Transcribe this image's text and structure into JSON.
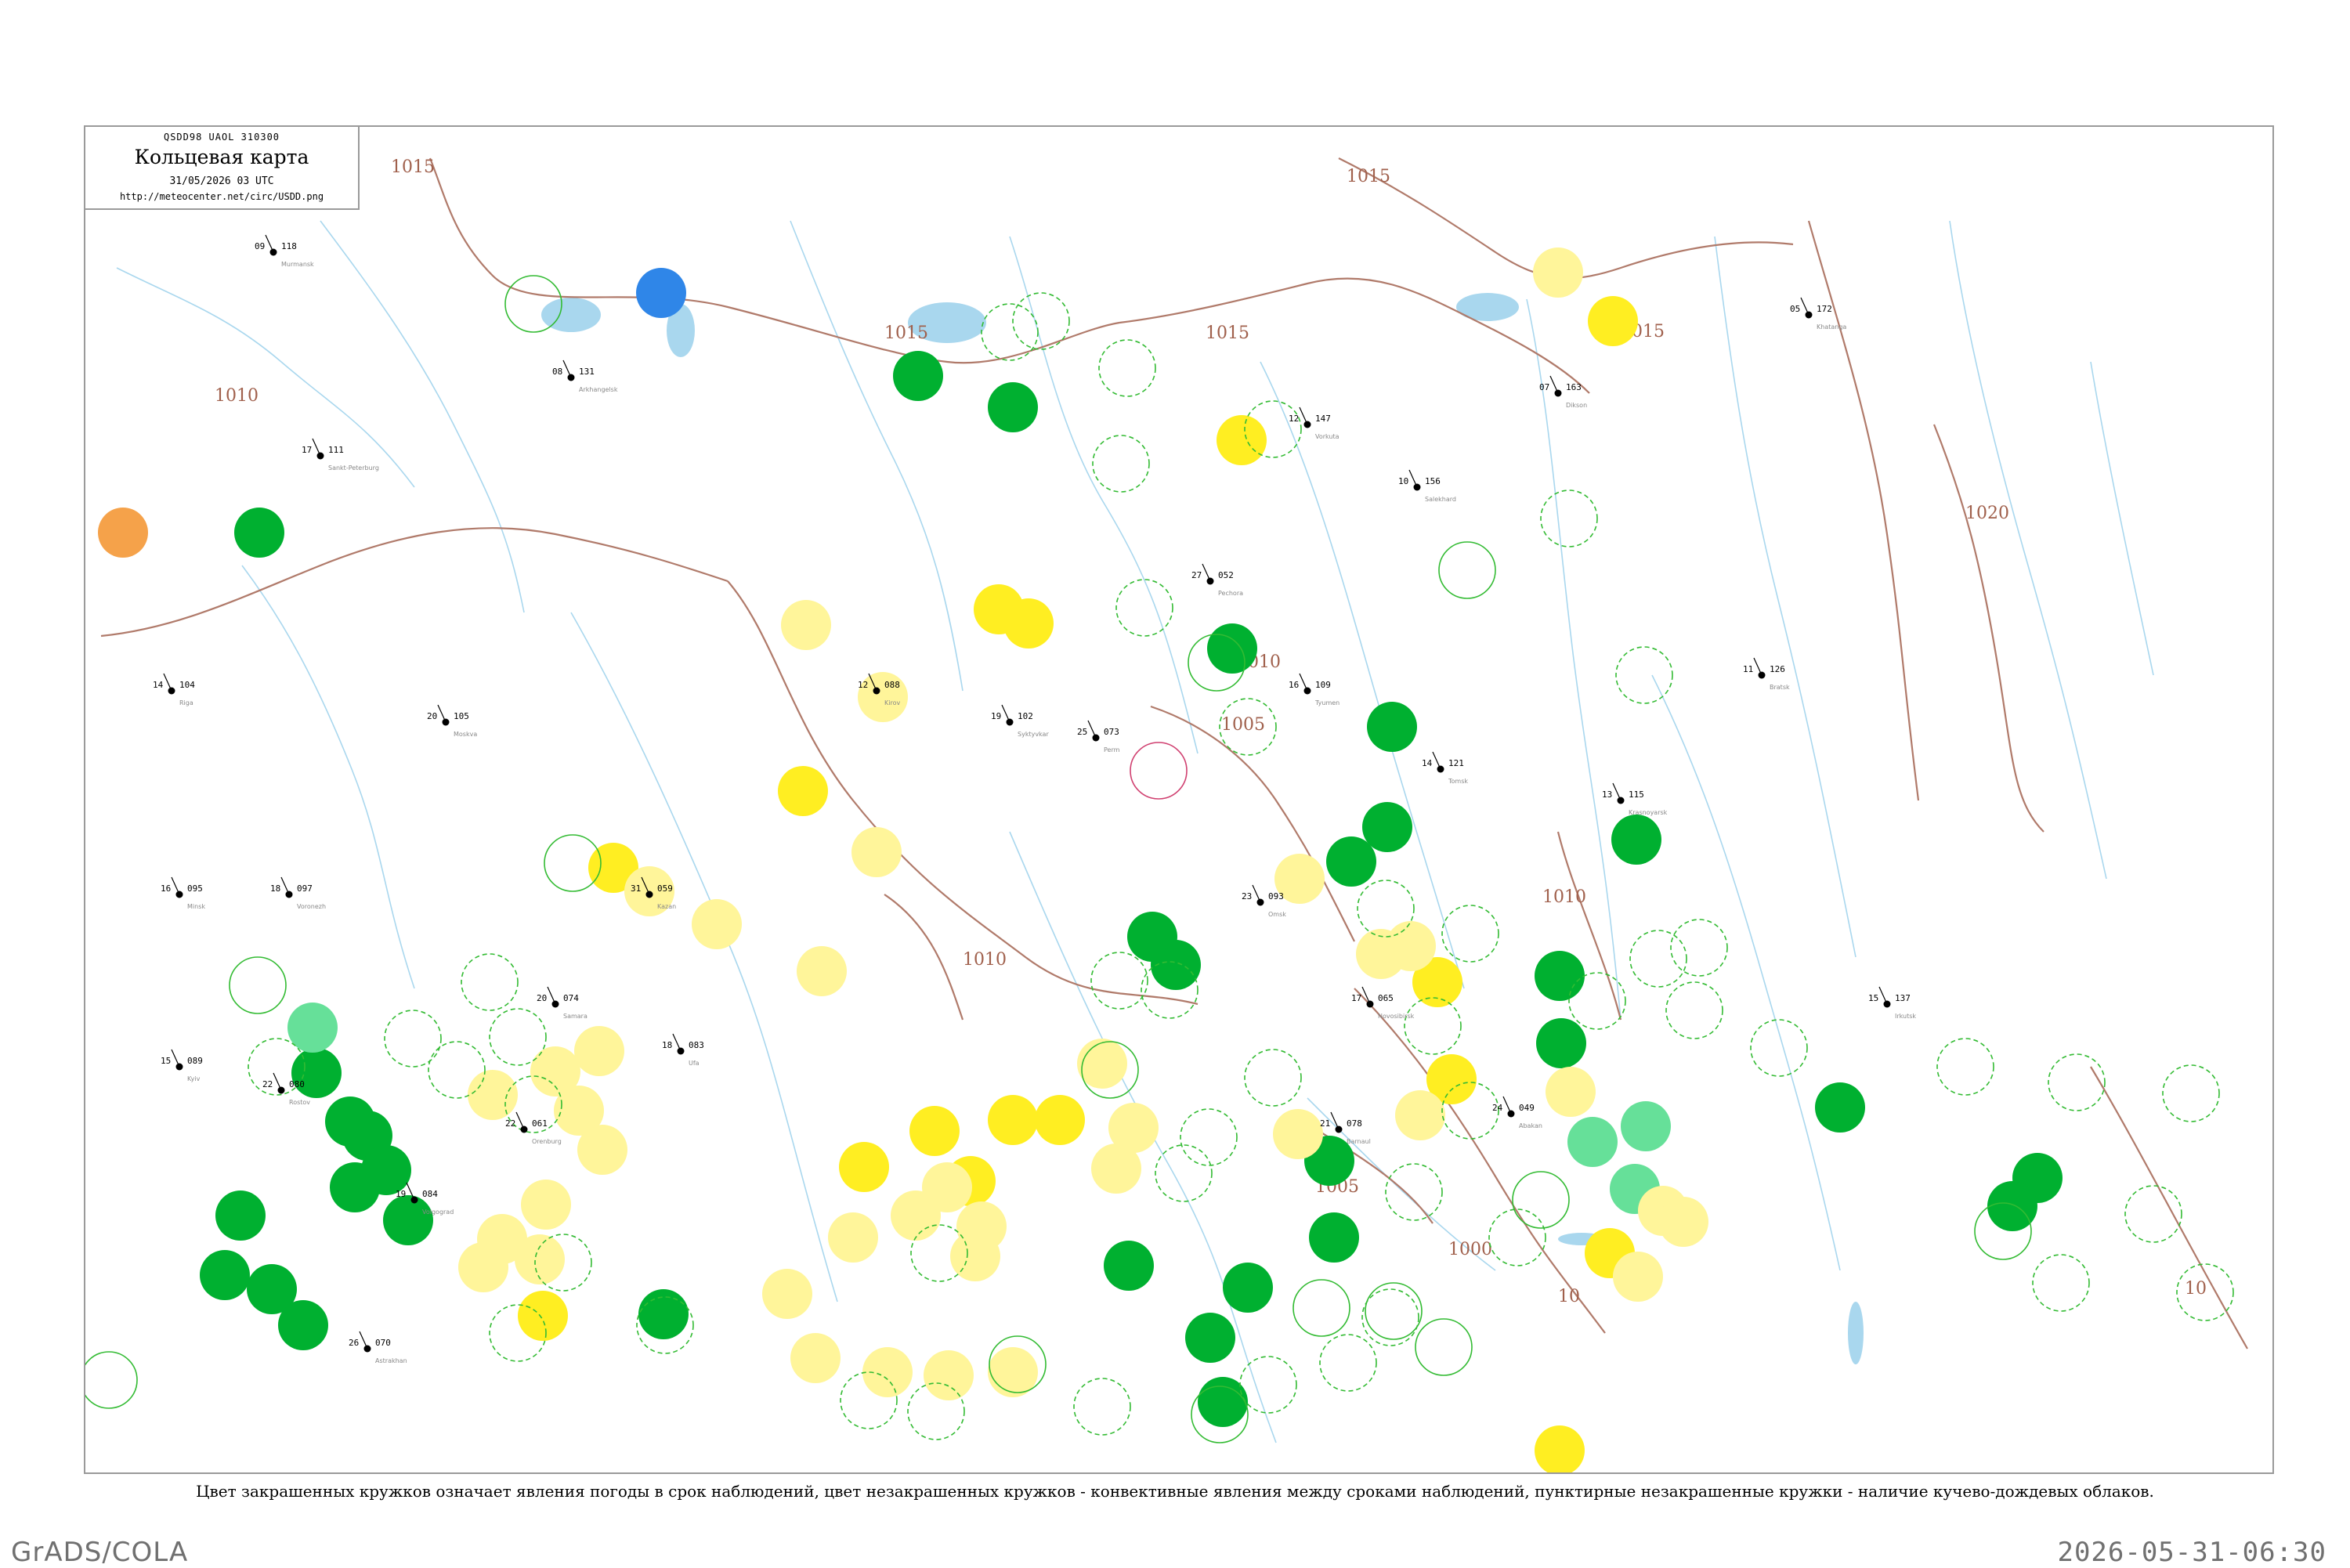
{
  "header": {
    "code_line": "QSDD98  UAOL  310300",
    "title": "Кольцевая карта",
    "datetime": "31/05/2026 03 UTC",
    "url": "http://meteocenter.net/circ/USDD.png"
  },
  "legend_caption": "Цвет закрашенных кружков означает явления погоды в срок наблюдений, цвет незакрашенных кружков - конвективные явления между сроками наблюдений, пунктирные незакрашенные кружки - наличие кучево-дождевых облаков.",
  "footer": {
    "left": "GrADS/COLA",
    "right": "2026-05-31-06:30"
  },
  "colors": {
    "isobar": "#b07a6a",
    "water": "#a9d7ee",
    "rain_green": "#00b030",
    "shower_light_green": "#66e099",
    "drizzle_yellow": "#ffee22",
    "haze_light_yellow": "#fff59a",
    "fog_blue": "#2f86e8",
    "dust_orange": "#f5a24a",
    "convective_ring": "#33bb33",
    "thunder_ring": "#d04070"
  },
  "isobar_labels": [
    "1015",
    "1015",
    "1015",
    "1015",
    "1015",
    "1010",
    "1010",
    "1010",
    "1005",
    "1000",
    "1010",
    "1020",
    "10",
    "10",
    "1005"
  ],
  "stations": [
    {
      "t": "27",
      "p": "052",
      "name": "Pechora"
    },
    {
      "t": "19",
      "p": "102",
      "name": "Syktyvkar"
    },
    {
      "t": "12",
      "p": "088",
      "name": "Kirov"
    },
    {
      "t": "25",
      "p": "073",
      "name": "Perm"
    },
    {
      "t": "31",
      "p": "059",
      "name": "Kazan"
    },
    {
      "t": "20",
      "p": "074",
      "name": "Samara"
    },
    {
      "t": "18",
      "p": "083",
      "name": "Ufa"
    },
    {
      "t": "22",
      "p": "061",
      "name": "Orenburg"
    },
    {
      "t": "16",
      "p": "109",
      "name": "Tyumen"
    },
    {
      "t": "23",
      "p": "093",
      "name": "Omsk"
    },
    {
      "t": "14",
      "p": "121",
      "name": "Tomsk"
    },
    {
      "t": "17",
      "p": "065",
      "name": "Novosibirsk"
    },
    {
      "t": "21",
      "p": "078",
      "name": "Barnaul"
    },
    {
      "t": "13",
      "p": "115",
      "name": "Krasnoyarsk"
    },
    {
      "t": "24",
      "p": "049",
      "name": "Abakan"
    },
    {
      "t": "15",
      "p": "137",
      "name": "Irkutsk"
    },
    {
      "t": "11",
      "p": "126",
      "name": "Bratsk"
    },
    {
      "t": "19",
      "p": "084",
      "name": "Volgograd"
    },
    {
      "t": "26",
      "p": "070",
      "name": "Astrakhan"
    },
    {
      "t": "18",
      "p": "097",
      "name": "Voronezh"
    },
    {
      "t": "20",
      "p": "105",
      "name": "Moskva"
    },
    {
      "t": "17",
      "p": "111",
      "name": "Sankt-Peterburg"
    },
    {
      "t": "09",
      "p": "118",
      "name": "Murmansk"
    },
    {
      "t": "08",
      "p": "131",
      "name": "Arkhangelsk"
    },
    {
      "t": "12",
      "p": "147",
      "name": "Vorkuta"
    },
    {
      "t": "10",
      "p": "156",
      "name": "Salekhard"
    },
    {
      "t": "07",
      "p": "163",
      "name": "Dikson"
    },
    {
      "t": "05",
      "p": "172",
      "name": "Khatanga"
    },
    {
      "t": "15",
      "p": "089",
      "name": "Kyiv"
    },
    {
      "t": "16",
      "p": "095",
      "name": "Minsk"
    },
    {
      "t": "22",
      "p": "080",
      "name": "Rostov"
    },
    {
      "t": "14",
      "p": "104",
      "name": "Riga"
    }
  ]
}
